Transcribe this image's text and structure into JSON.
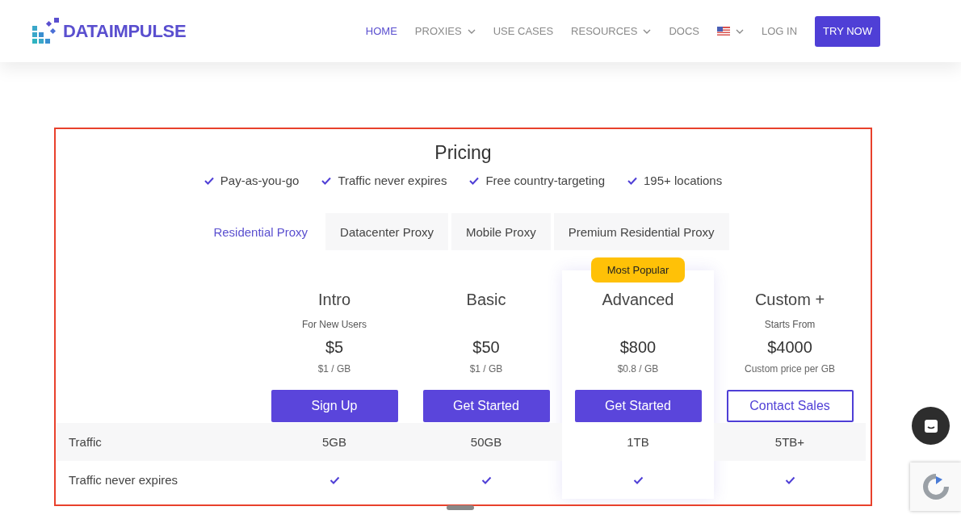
{
  "header": {
    "logo": "DATAIMPULSE",
    "nav": [
      {
        "kind": "link",
        "label": "HOME",
        "selected": true
      },
      {
        "kind": "dropdown",
        "label": "PROXIES",
        "selected": false
      },
      {
        "kind": "link",
        "label": "USE CASES",
        "selected": false
      },
      {
        "kind": "dropdown",
        "label": "RESOURCES",
        "selected": false
      },
      {
        "kind": "link",
        "label": "DOCS",
        "selected": false
      },
      {
        "kind": "language"
      },
      {
        "kind": "link",
        "label": "LOG IN",
        "selected": false
      }
    ],
    "cta": "TRY NOW"
  },
  "pricing": {
    "title": "Pricing",
    "features": [
      "Pay-as-you-go",
      "Traffic never expires",
      "Free country-targeting",
      "195+ locations"
    ],
    "tabs": [
      {
        "label": "Residential Proxy",
        "selected": true
      },
      {
        "label": "Datacenter Proxy",
        "selected": false
      },
      {
        "label": "Mobile Proxy",
        "selected": false
      },
      {
        "label": "Premium Residential Proxy",
        "selected": false
      }
    ],
    "plans": [
      {
        "name": "Intro",
        "note": "For New Users",
        "price": "$5",
        "unit": "$1 / GB",
        "button": "Sign Up",
        "kind": "filled",
        "featured": false
      },
      {
        "name": "Basic",
        "price": "$50",
        "unit": "$1 / GB",
        "button": "Get Started",
        "kind": "filled",
        "featured": false
      },
      {
        "name": "Advanced",
        "badge": "Most Popular",
        "price": "$800",
        "unit": "$0.8 / GB",
        "button": "Get Started",
        "kind": "filled",
        "featured": true
      },
      {
        "name": "Custom +",
        "note": "Starts From",
        "price": "$4000",
        "unit": "Custom price per GB",
        "button": "Contact Sales",
        "kind": "outline",
        "featured": false
      }
    ],
    "rows": [
      {
        "label": "Traffic",
        "kind": "text",
        "cells": [
          {
            "text": "5GB"
          },
          {
            "text": "50GB"
          },
          {
            "text": "1TB"
          },
          {
            "text": "5TB+"
          }
        ]
      },
      {
        "label": "Traffic never expires",
        "kind": "check",
        "cells": [
          {
            "checked": true
          },
          {
            "checked": true
          },
          {
            "checked": true
          },
          {
            "checked": true
          }
        ]
      }
    ]
  }
}
